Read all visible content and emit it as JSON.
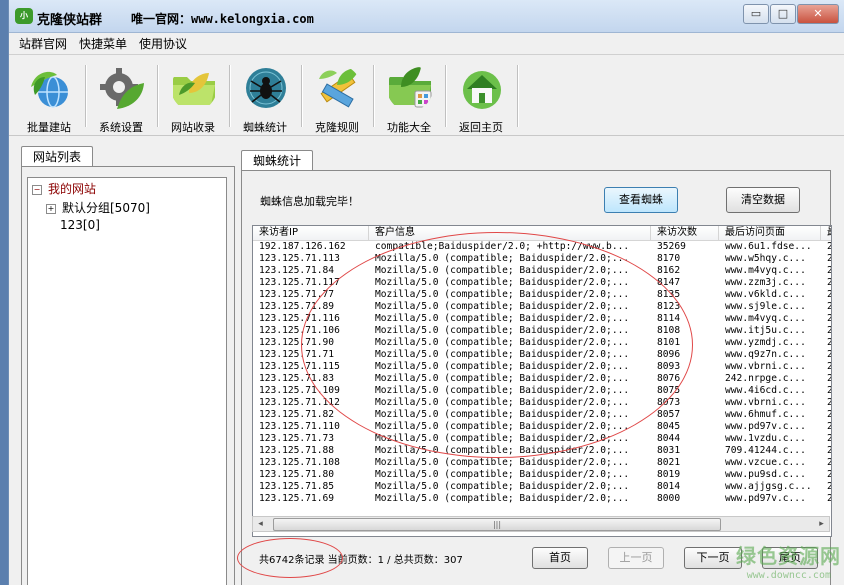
{
  "titlebar": {
    "logo_text": "小",
    "title": "克隆侠站群",
    "site": "唯一官网：www.kelongxia.com",
    "minimize": "▭",
    "maximize": "□",
    "close": "✕"
  },
  "menu": [
    "站群官网",
    "快捷菜单",
    "使用协议"
  ],
  "toolbar": [
    {
      "label": "批量建站",
      "icon": "globe-leaf-icon",
      "color": "#4aa93c"
    },
    {
      "label": "系统设置",
      "icon": "gear-leaf-icon",
      "color": "#56a830"
    },
    {
      "label": "网站收录",
      "icon": "folder-leaf-icon",
      "color": "#7fb83a"
    },
    {
      "label": "蜘蛛统计",
      "icon": "spider-icon",
      "color": "#3b8fa8"
    },
    {
      "label": "克隆规则",
      "icon": "ruler-leaf-icon",
      "color": "#8cb94a"
    },
    {
      "label": "功能大全",
      "icon": "folder-apps-icon",
      "color": "#5aab3a"
    },
    {
      "label": "返回主页",
      "icon": "home-icon",
      "color": "#4ea24a"
    }
  ],
  "left_tab": "网站列表",
  "tree": {
    "root": "我的网站",
    "group": "默认分组[5070]",
    "leaf": "123[0]"
  },
  "right_tab": "蜘蛛统计",
  "status": "蜘蛛信息加载完毕！",
  "buttons": {
    "view_spider": "查看蜘蛛",
    "clear_data": "清空数据",
    "first": "首页",
    "prev": "上一页",
    "next": "下一页",
    "last": "尾页"
  },
  "grid": {
    "columns": [
      "来访者IP",
      "客户信息",
      "来访次数",
      "最后访问页面",
      "最"
    ],
    "rows": [
      [
        "192.187.126.162",
        "compatible;Baiduspider/2.0; +http://www.b...",
        "35269",
        "www.6u1.fdse...",
        "2"
      ],
      [
        "123.125.71.113",
        "Mozilla/5.0 (compatible; Baiduspider/2.0;...",
        "8170",
        "www.w5hqy.c...",
        "2"
      ],
      [
        "123.125.71.84",
        "Mozilla/5.0 (compatible; Baiduspider/2.0;...",
        "8162",
        "www.m4vyq.c...",
        "2"
      ],
      [
        "123.125.71.117",
        "Mozilla/5.0 (compatible; Baiduspider/2.0;...",
        "8147",
        "www.zzm3j.c...",
        "2"
      ],
      [
        "123.125.71.77",
        "Mozilla/5.0 (compatible; Baiduspider/2.0;...",
        "8135",
        "www.v6kld.c...",
        "2"
      ],
      [
        "123.125.71.89",
        "Mozilla/5.0 (compatible; Baiduspider/2.0;...",
        "8123",
        "www.sj9le.c...",
        "2"
      ],
      [
        "123.125.71.116",
        "Mozilla/5.0 (compatible; Baiduspider/2.0;...",
        "8114",
        "www.m4vyq.c...",
        "2"
      ],
      [
        "123.125.71.106",
        "Mozilla/5.0 (compatible; Baiduspider/2.0;...",
        "8108",
        "www.itj5u.c...",
        "2"
      ],
      [
        "123.125.71.90",
        "Mozilla/5.0 (compatible; Baiduspider/2.0;...",
        "8101",
        "www.yzmdj.c...",
        "2"
      ],
      [
        "123.125.71.71",
        "Mozilla/5.0 (compatible; Baiduspider/2.0;...",
        "8096",
        "www.q9z7n.c...",
        "2"
      ],
      [
        "123.125.71.115",
        "Mozilla/5.0 (compatible; Baiduspider/2.0;...",
        "8093",
        "www.vbrni.c...",
        "2"
      ],
      [
        "123.125.71.83",
        "Mozilla/5.0 (compatible; Baiduspider/2.0;...",
        "8076",
        "242.nrpge.c...",
        "2"
      ],
      [
        "123.125.71.109",
        "Mozilla/5.0 (compatible; Baiduspider/2.0;...",
        "8075",
        "www.4i6cd.c...",
        "2"
      ],
      [
        "123.125.71.112",
        "Mozilla/5.0 (compatible; Baiduspider/2.0;...",
        "8073",
        "www.vbrni.c...",
        "2"
      ],
      [
        "123.125.71.82",
        "Mozilla/5.0 (compatible; Baiduspider/2.0;...",
        "8057",
        "www.6hmuf.c...",
        "2"
      ],
      [
        "123.125.71.110",
        "Mozilla/5.0 (compatible; Baiduspider/2.0;...",
        "8045",
        "www.pd97v.c...",
        "2"
      ],
      [
        "123.125.71.73",
        "Mozilla/5.0 (compatible; Baiduspider/2.0;...",
        "8044",
        "www.1vzdu.c...",
        "2"
      ],
      [
        "123.125.71.88",
        "Mozilla/5.0 (compatible; Baiduspider/2.0;...",
        "8031",
        "709.41244.c...",
        "2"
      ],
      [
        "123.125.71.108",
        "Mozilla/5.0 (compatible; Baiduspider/2.0;...",
        "8021",
        "www.vzcue.c...",
        "2"
      ],
      [
        "123.125.71.80",
        "Mozilla/5.0 (compatible; Baiduspider/2.0;...",
        "8019",
        "www.pu9sd.c...",
        "2"
      ],
      [
        "123.125.71.85",
        "Mozilla/5.0 (compatible; Baiduspider/2.0;...",
        "8014",
        "www.ajjgsg.c...",
        "2"
      ],
      [
        "123.125.71.69",
        "Mozilla/5.0 (compatible; Baiduspider/2.0;...",
        "8000",
        "www.pd97v.c...",
        "2"
      ]
    ]
  },
  "scroll": {
    "left": "◂",
    "right": "▸",
    "thumb": "|||"
  },
  "pagination": {
    "records": "共6742条记录 当前页数：1 / 总共页数：307"
  },
  "watermark": {
    "main": "绿色资源网",
    "sub": "www.downcc.com"
  },
  "colors": {
    "annotation": "#e04848",
    "primary_button": "#bee6fd"
  }
}
